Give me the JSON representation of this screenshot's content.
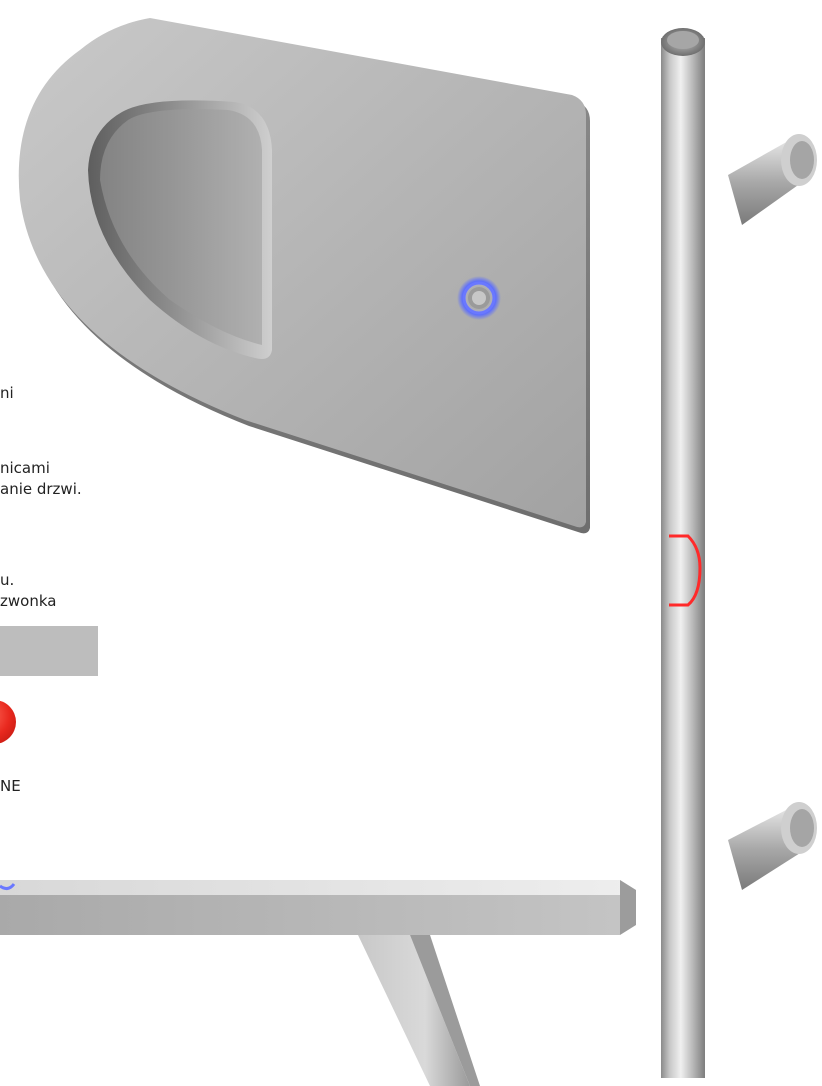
{
  "text_fragments": {
    "line_1": "ni",
    "line_2": "nicami",
    "line_3": "anie drzwi.",
    "line_4": "u.",
    "line_5": "zwonka",
    "line_6": "NE"
  },
  "icons": {
    "flush_handle_button": "illuminated-push-button-icon",
    "bar_handle_button": "illuminated-push-button-icon"
  },
  "colors": {
    "steel": "#b9b9b9",
    "led_blue": "#5a6cff",
    "led_red": "#ff2a2a",
    "badge_red": "#e8281e",
    "bar_gray": "#bdbdbd"
  }
}
